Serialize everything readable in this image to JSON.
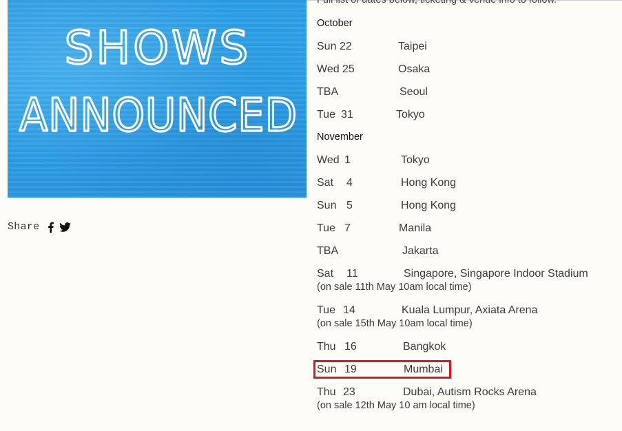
{
  "intro_text": "Full list of dates below, ticketing & venue info to follow.",
  "promo": {
    "line1": "SHOWS",
    "line2": "ANNOUNCED",
    "bg_color": "#2fa6ec"
  },
  "share": {
    "label": "Share",
    "icons": [
      "facebook-icon",
      "twitter-icon"
    ]
  },
  "months": [
    {
      "name": "October",
      "shows": [
        {
          "day": "Sun",
          "date": "22",
          "city": "Taipei"
        },
        {
          "day": "Wed",
          "date": "25",
          "city": "Osaka"
        },
        {
          "day": "TBA",
          "date": "",
          "city": "Seoul"
        },
        {
          "day": "Tue",
          "date": "31",
          "city": "Tokyo"
        }
      ]
    },
    {
      "name": "November",
      "shows": [
        {
          "day": "Wed",
          "date": "1",
          "city": "Tokyo"
        },
        {
          "day": "Sat",
          "date": "4",
          "city": "Hong Kong"
        },
        {
          "day": "Sun",
          "date": "5",
          "city": "Hong Kong"
        },
        {
          "day": "Tue",
          "date": "7",
          "city": "Manila"
        },
        {
          "day": "TBA",
          "date": "",
          "city": "Jakarta"
        },
        {
          "day": "Sat",
          "date": "11",
          "city": "Singapore, Singapore Indoor Stadium",
          "note": "(on sale 11th May 10am local time)"
        },
        {
          "day": "Tue",
          "date": "14",
          "city": "Kuala Lumpur, Axiata Arena",
          "note": "(on sale 15th May 10am local time)"
        },
        {
          "day": "Thu",
          "date": "16",
          "city": "Bangkok"
        },
        {
          "day": "Sun",
          "date": "19",
          "city": "Mumbai",
          "highlighted": true
        },
        {
          "day": "Thu",
          "date": "23",
          "city": "Dubai, Autism Rocks Arena",
          "note": "(on sale 12th May 10 am local time)"
        }
      ]
    }
  ],
  "highlight_color": "#e0141b"
}
